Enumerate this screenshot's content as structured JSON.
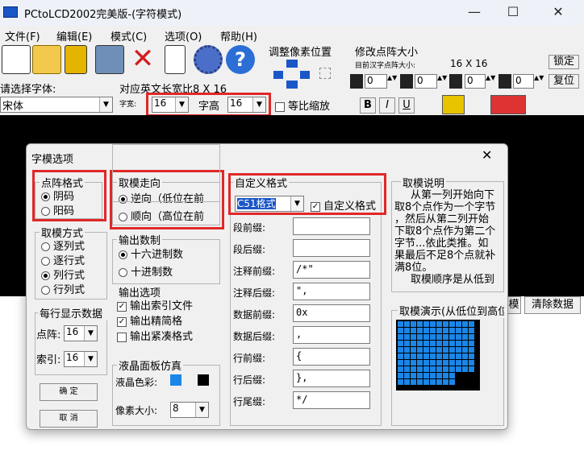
{
  "window": {
    "title": "PCtoLCD2002完美版-(字符模式)",
    "minimize": "—",
    "maximize": "☐",
    "close": "✕"
  },
  "menu": [
    "文件(F)",
    "编辑(E)",
    "模式(C)",
    "选项(O)",
    "帮助(H)"
  ],
  "toolbar": {
    "icons": [
      "new-file-icon",
      "open-folder-icon",
      "save-icon",
      "export-icon",
      "delete-icon",
      "notes-icon",
      "settings-gear-icon",
      "help-icon"
    ],
    "adjust_pos_label": "调整像素位置",
    "modify_size_label": "修改点阵大小",
    "current_size_caption": "目前汉字点阵大小:",
    "current_size_value": "16 X 16",
    "lock_button": "锁定",
    "restore_button": "复位",
    "spin_values": [
      "0",
      "0",
      "0",
      "0"
    ],
    "font_select_label": "请选择字体:",
    "font_value": "宋体",
    "en_ratio_label": "对应英文长宽比8 X 16",
    "width_caption": "字宽:",
    "width_value": "16",
    "height_label": "字高",
    "height_value": "16",
    "equal_scale_label": "等比缩放",
    "style_buttons": [
      "B",
      "I",
      "U"
    ]
  },
  "right_buttons": {
    "partial": "模",
    "clear_data": "清除数据"
  },
  "dialog": {
    "title": "字模选项",
    "close": "✕",
    "dot_format": {
      "title": "点阵格式",
      "options": [
        "阴码",
        "阳码"
      ],
      "selected": 0
    },
    "direction": {
      "title": "取模走向",
      "options": [
        "逆向（低位在前",
        "顺向（高位在前"
      ],
      "selected": 0
    },
    "custom_format": {
      "title": "自定义格式",
      "format_value": "C51格式",
      "custom_checkbox": "自定义格式",
      "custom_checked": true
    },
    "mode": {
      "title": "取模方式",
      "options": [
        "逐列式",
        "逐行式",
        "列行式",
        "行列式"
      ],
      "selected": 2
    },
    "output_base": {
      "title": "输出数制",
      "options": [
        "十六进制数",
        "十进制数"
      ],
      "selected": 0
    },
    "output_options": {
      "title": "输出选项",
      "options": [
        "输出索引文件",
        "输出精简格",
        "输出紧凑格式"
      ],
      "checked": [
        true,
        true,
        false
      ]
    },
    "per_line": {
      "title": "每行显示数据",
      "dot_label": "点阵:",
      "dot_value": "16",
      "index_label": "索引:",
      "index_value": "16"
    },
    "lcd": {
      "title": "液晶面板仿真",
      "color_label": "液晶色彩:",
      "color_on": "#1a86e8",
      "color_off": "#000000",
      "pixel_label": "像素大小:",
      "pixel_value": "8"
    },
    "fields": [
      {
        "label": "段前缀:",
        "value": ""
      },
      {
        "label": "段后缀:",
        "value": ""
      },
      {
        "label": "注释前缀:",
        "value": "/*\""
      },
      {
        "label": "注释后缀:",
        "value": "\","
      },
      {
        "label": "数据前缀:",
        "value": "0x"
      },
      {
        "label": "数据后缀:",
        "value": ","
      },
      {
        "label": "行前缀:",
        "value": "{"
      },
      {
        "label": "行后缀:",
        "value": "},"
      },
      {
        "label": "行尾缀:",
        "value": "*/"
      }
    ],
    "explain": {
      "title": "取模说明",
      "lines": [
        "从第一列开始向下",
        "取8个点作为一个字节",
        "，然后从第二列开始",
        "下取8个点作为第二个",
        "字节...依此类推。如",
        "果最后不足8个点就补",
        "满8位。",
        "取模顺序是从低到"
      ]
    },
    "demo_title": "取模演示(从低位到高位",
    "ok_button": "确  定",
    "cancel_button": "取  消"
  }
}
